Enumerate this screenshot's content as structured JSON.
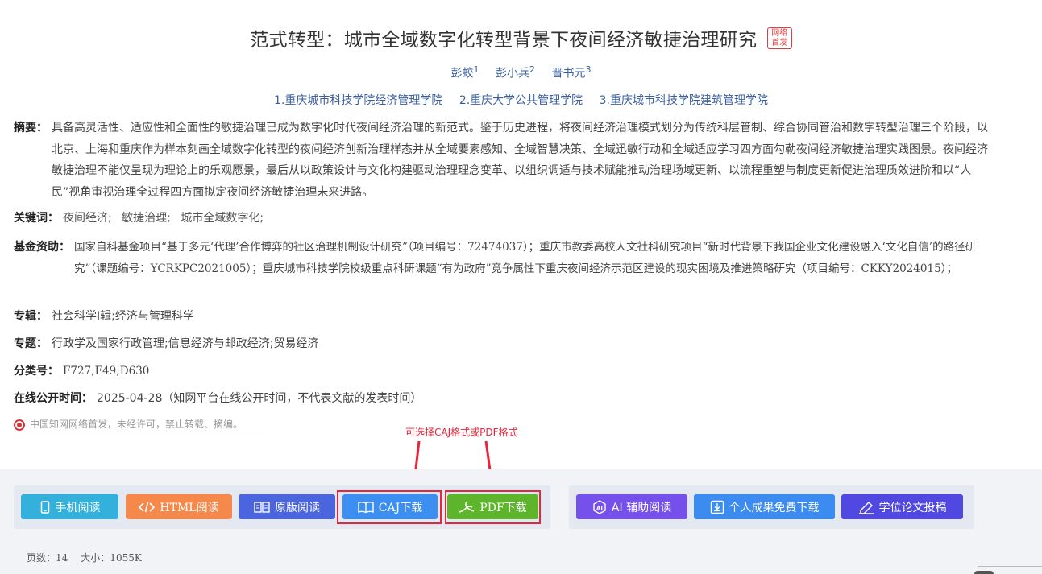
{
  "article": {
    "title": "范式转型：城市全域数字化转型背景下夜间经济敏捷治理研究",
    "badge_line1": "网络",
    "badge_line2": "首发",
    "authors": [
      {
        "name": "彭蛟",
        "sup": "1"
      },
      {
        "name": "彭小兵",
        "sup": "2"
      },
      {
        "name": "晋书元",
        "sup": "3"
      }
    ],
    "affiliations": [
      "1.重庆城市科技学院经济管理学院",
      "2.重庆大学公共管理学院",
      "3.重庆城市科技学院建筑管理学院"
    ]
  },
  "abstract": {
    "label": "摘要：",
    "text": "具备高灵活性、适应性和全面性的敏捷治理已成为数字化时代夜间经济治理的新范式。鉴于历史进程，将夜间经济治理模式划分为传统科层管制、综合协同管治和数字转型治理三个阶段，以北京、上海和重庆作为样本刻画全域数字化转型的夜间经济创新治理样态并从全域要素感知、全域智慧决策、全域迅敏行动和全域适应学习四方面勾勒夜间经济敏捷治理实践图景。夜间经济敏捷治理不能仅呈现为理论上的乐观愿景，最后从以政策设计与文化构建驱动治理理念变革、以组织调适与技术赋能推动治理场域更新、以流程重塑与制度更新促进治理质效进阶和以“人民”视角审视治理全过程四方面拟定夜间经济敏捷治理未来进路。"
  },
  "keywords": {
    "label": "关键词：",
    "items": [
      "夜间经济;",
      "敏捷治理;",
      "城市全域数字化;"
    ]
  },
  "fund": {
    "label": "基金资助：",
    "text": "国家自科基金项目“基于多元‘代理’合作博弈的社区治理机制设计研究”（项目编号：72474037）；重庆市教委高校人文社科研究项目“新时代背景下我国企业文化建设融入‘文化自信’的路径研究”（课题编号：YCRKPC2021005）；重庆城市科技学院校级重点科研课题“有为政府”竞争属性下重庆夜间经济示范区建设的现实困境及推进策略研究（项目编号：CKKY2024015）；"
  },
  "album": {
    "label": "专辑：",
    "value": "社会科学Ⅰ辑;经济与管理科学"
  },
  "topic": {
    "label": "专题：",
    "value": "行政学及国家行政管理;信息经济与邮政经济;贸易经济"
  },
  "clc": {
    "label": "分类号：",
    "value": "F727;F49;D630"
  },
  "pubtime": {
    "label": "在线公开时间：",
    "value": "2025-04-28（知网平台在线公开时间，不代表文献的发表时间）"
  },
  "copyright": "中国知网网络首发，未经许可，禁止转载、摘编。",
  "annotation": "可选择CAJ格式或PDF格式",
  "buttons": {
    "mobile": "手机阅读",
    "html": "HTML阅读",
    "original": "原版阅读",
    "caj": "CAJ下载",
    "pdf": "PDF下载",
    "ai": "AI 辅助阅读",
    "free": "个人成果免费下载",
    "thesis": "学位论文投稿"
  },
  "meta": {
    "pages_label": "页数：",
    "pages": "14",
    "size_label": "大小：",
    "size": "1055K"
  },
  "colors": {
    "accent_red": "#e8253a",
    "mobile": "#33b1dc",
    "html": "#f5894c",
    "original": "#4b65de",
    "caj": "#3c8ff0",
    "pdf": "#5db52c",
    "ai": "#7650ea",
    "free": "#3b8bf0",
    "thesis": "#5048e0"
  },
  "icons": [
    "phone-icon",
    "code-icon",
    "book-icon",
    "open-book-icon",
    "pdf-icon",
    "ai-icon",
    "download-icon",
    "pen-icon",
    "copyright-icon"
  ]
}
